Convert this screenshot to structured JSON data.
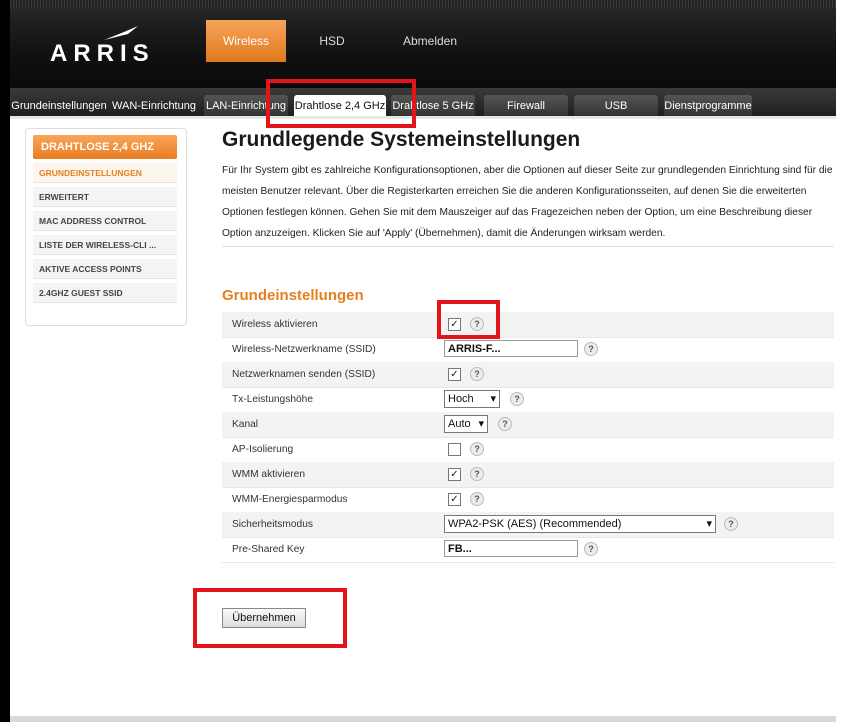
{
  "brand": {
    "logo_text": "ARRIS"
  },
  "main_nav": [
    {
      "label": "Wireless",
      "active": true
    },
    {
      "label": "HSD",
      "active": false
    },
    {
      "label": "Abmelden",
      "active": false
    }
  ],
  "sub_tabs": [
    {
      "label": "Grundeinstellungen"
    },
    {
      "label": "WAN-Einrichtung"
    },
    {
      "label": "LAN-Einrichtung"
    },
    {
      "label": "Drahtlose 2,4 GHz"
    },
    {
      "label": "Drahtlose 5 GHz"
    },
    {
      "label": "Firewall"
    },
    {
      "label": "USB"
    },
    {
      "label": "Dienstprogramme"
    }
  ],
  "sidebar": {
    "header": "DRAHTLOSE 2,4 GHZ",
    "items": [
      {
        "label": "GRUNDEINSTELLUNGEN",
        "active": true
      },
      {
        "label": "ERWEITERT"
      },
      {
        "label": "MAC ADDRESS CONTROL"
      },
      {
        "label": "LISTE DER WIRELESS-CLI ..."
      },
      {
        "label": "AKTIVE ACCESS POINTS"
      },
      {
        "label": "2.4GHZ GUEST SSID"
      }
    ]
  },
  "content": {
    "title": "Grundlegende Systemeinstellungen",
    "intro": "Für Ihr System gibt es zahlreiche Konfigurationsoptionen, aber die Optionen auf dieser Seite zur grundlegenden Einrichtung sind für die meisten Benutzer relevant. Über die Registerkarten erreichen Sie die anderen Konfigurationsseiten, auf denen Sie die erweiterten Optionen festlegen können. Gehen Sie mit dem Mauszeiger auf das Fragezeichen neben der Option, um eine Beschreibung dieser Option anzuzeigen. Klicken Sie auf 'Apply' (Übernehmen), damit die Änderungen wirksam werden.",
    "section_title": "Grundeinstellungen",
    "help_glyph": "?",
    "checkmark": "✓",
    "dropdown_glyph": "▾",
    "rows": {
      "wireless_enable": {
        "label": "Wireless aktivieren",
        "checked": true
      },
      "ssid": {
        "label": "Wireless-Netzwerkname (SSID)",
        "value": "ARRIS-F..."
      },
      "broadcast_ssid": {
        "label": "Netzwerknamen senden (SSID)",
        "checked": true
      },
      "tx_power": {
        "label": "Tx-Leistungshöhe",
        "value": "Hoch"
      },
      "channel": {
        "label": "Kanal",
        "value": "Auto"
      },
      "ap_isolation": {
        "label": "AP-Isolierung",
        "checked": false
      },
      "wmm": {
        "label": "WMM aktivieren",
        "checked": true
      },
      "wmm_power": {
        "label": "WMM-Energiesparmodus",
        "checked": true
      },
      "security_mode": {
        "label": "Sicherheitsmodus",
        "value": "WPA2-PSK (AES) (Recommended)"
      },
      "psk": {
        "label": "Pre-Shared Key",
        "value": "FB..."
      }
    },
    "apply_button": "Übernehmen"
  },
  "colors": {
    "accent_orange": "#e6801f",
    "highlight_red": "#e4141b",
    "topbar": "#111111"
  }
}
